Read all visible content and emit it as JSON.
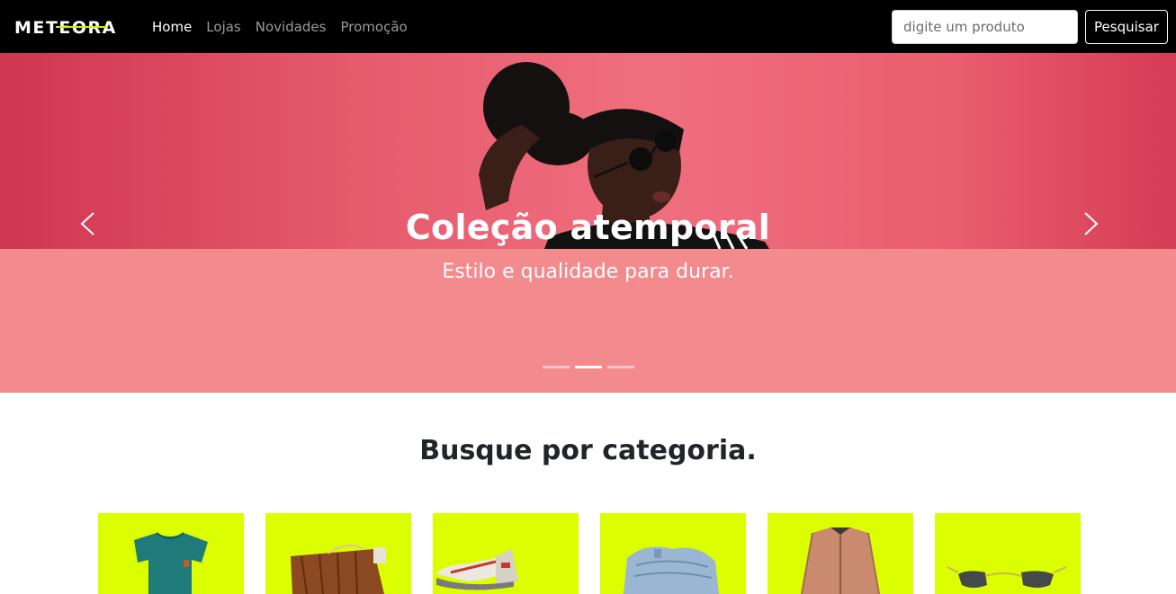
{
  "navbar": {
    "logo_text": "METEORA",
    "links": [
      {
        "label": "Home",
        "active": true
      },
      {
        "label": "Lojas",
        "active": false
      },
      {
        "label": "Novidades",
        "active": false
      },
      {
        "label": "Promoção",
        "active": false
      }
    ],
    "search": {
      "placeholder": "digite um produto",
      "value": ""
    },
    "search_button_label": "Pesquisar"
  },
  "hero": {
    "title": "Coleção atemporal",
    "subtitle": "Estilo e qualidade para durar.",
    "slide_count": 3,
    "active_slide": 2,
    "prev_icon": "chevron-left-icon",
    "next_icon": "chevron-right-icon"
  },
  "categories": {
    "title": "Busque por categoria.",
    "items": [
      {
        "icon": "tshirt-icon"
      },
      {
        "icon": "handbag-icon"
      },
      {
        "icon": "sneaker-icon"
      },
      {
        "icon": "jeans-icon"
      },
      {
        "icon": "jacket-icon"
      },
      {
        "icon": "sunglasses-icon"
      }
    ]
  },
  "colors": {
    "navbar_bg": "#000000",
    "hero_pink": "#f38a8e",
    "category_bg": "#dcff00",
    "logo_accent": "#c8f000"
  }
}
